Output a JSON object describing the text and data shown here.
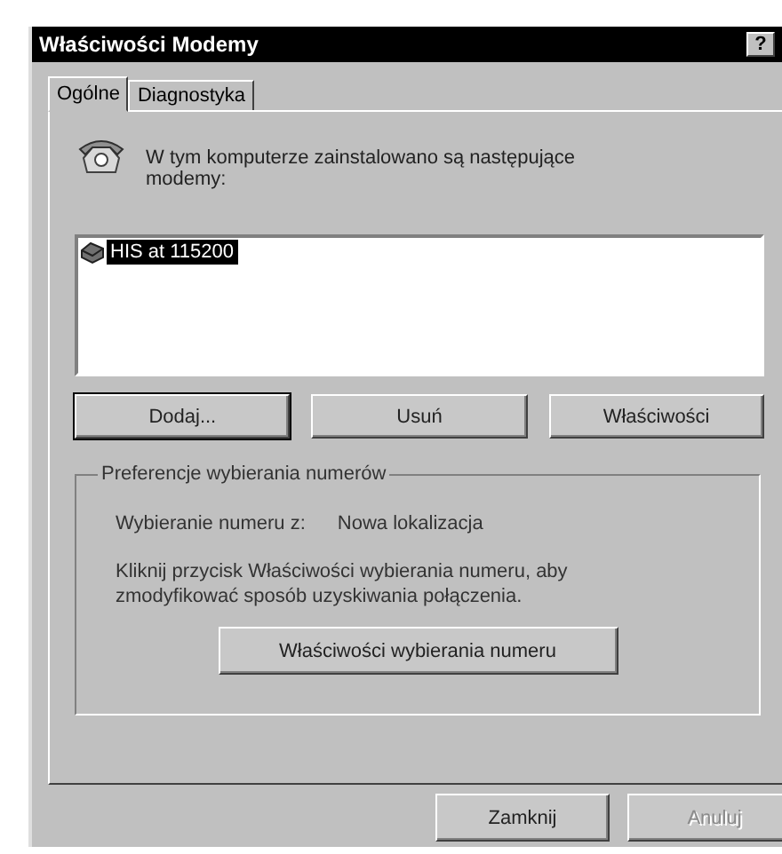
{
  "window": {
    "title": "Właściwości Modemy",
    "help_button": "?"
  },
  "tabs": [
    {
      "label": "Ogólne",
      "selected": true
    },
    {
      "label": "Diagnostyka",
      "selected": false
    }
  ],
  "intro": "W tym komputerze zainstalowano są następujące modemy:",
  "modems": [
    {
      "name": "HIS at 115200",
      "selected": true
    }
  ],
  "modem_buttons": [
    {
      "label": "Dodaj...",
      "focused": true
    },
    {
      "label": "Usuń",
      "focused": false
    },
    {
      "label": "Właściwości",
      "focused": false
    }
  ],
  "dialing": {
    "title": "Preferencje wybierania numerów",
    "from_label": "Wybieranie numeru z:",
    "from_value": "Nowa lokalizacja",
    "hint": "Kliknij przycisk Właściwości wybierania numeru, aby zmodyfikować sposób uzyskiwania połączenia.",
    "button": "Właściwości wybierania numeru"
  },
  "footer_buttons": [
    {
      "label": "Zamknij",
      "disabled": false
    },
    {
      "label": "Anuluj",
      "disabled": true
    }
  ]
}
